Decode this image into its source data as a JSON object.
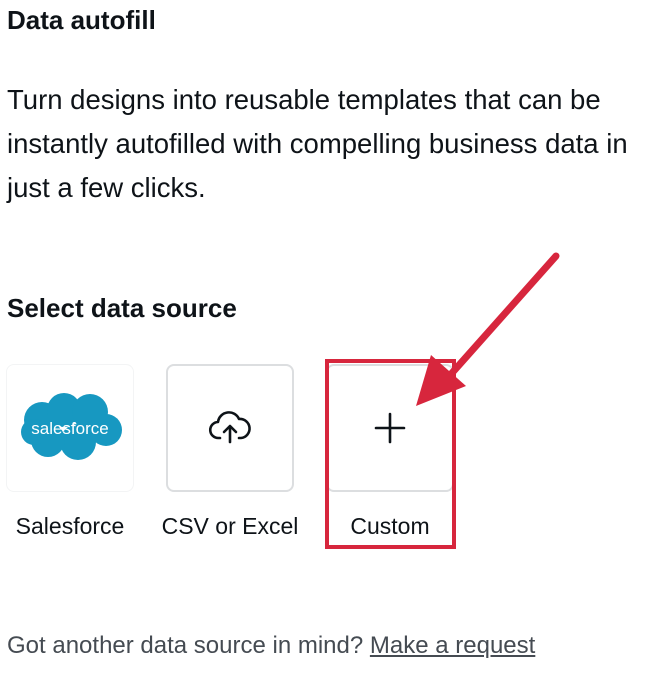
{
  "header": {
    "title": "Data autofill",
    "description": "Turn designs into reusable templates that can be instantly autofilled with compelling business data in just a few clicks."
  },
  "data_source": {
    "heading": "Select data source",
    "options": [
      {
        "label": "Salesforce",
        "icon": "salesforce-logo",
        "logo_text": "salesforce",
        "logo_color": "#1798c1"
      },
      {
        "label": "CSV or Excel",
        "icon": "cloud-upload-icon"
      },
      {
        "label": "Custom",
        "icon": "plus-icon"
      }
    ]
  },
  "annotation": {
    "color": "#d7263d",
    "highlighted_option": "Custom"
  },
  "footer": {
    "prompt": "Got another data source in mind?",
    "link_label": "Make a request"
  }
}
